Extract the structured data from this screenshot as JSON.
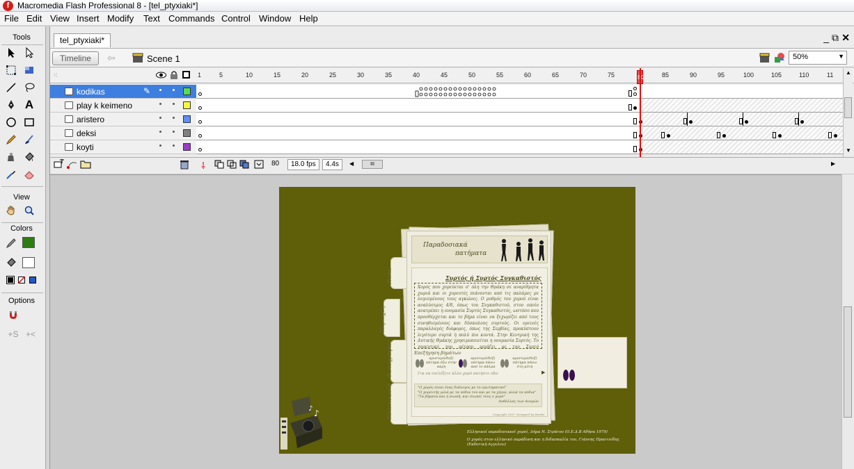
{
  "window": {
    "title": "Macromedia Flash Professional 8 - [tel_ptyxiaki*]",
    "logo_letter": "f"
  },
  "menu": [
    "File",
    "Edit",
    "View",
    "Insert",
    "Modify",
    "Text",
    "Commands",
    "Control",
    "Window",
    "Help"
  ],
  "tools_panel": {
    "header": "Tools",
    "view_header": "View",
    "colors_header": "Colors",
    "options_header": "Options",
    "text_tool_glyph": "A",
    "stroke_color": "#1a1a1a",
    "fill_color": "#2e7d12"
  },
  "document": {
    "tab_label": "tel_ptyxiaki*",
    "timeline_button": "Timeline",
    "scene_label": "Scene 1",
    "zoom": "50%"
  },
  "timeline": {
    "frame_numbers": [
      "1",
      "5",
      "10",
      "15",
      "20",
      "25",
      "30",
      "35",
      "40",
      "45",
      "50",
      "55",
      "60",
      "65",
      "70",
      "75",
      "80",
      "85",
      "90",
      "95",
      "100",
      "105",
      "110",
      "11"
    ],
    "current_frame": "80",
    "fps": "18.0 fps",
    "elapsed": "4.4s",
    "layers": [
      {
        "name": "kodikas",
        "color": "#55dd55",
        "selected": true
      },
      {
        "name": "play k keimeno",
        "color": "#f7f742",
        "selected": false
      },
      {
        "name": "aristero",
        "color": "#5b8ff5",
        "selected": false
      },
      {
        "name": "deksi",
        "color": "#808080",
        "selected": false
      },
      {
        "name": "koyti",
        "color": "#9a3ac8",
        "selected": false
      }
    ]
  },
  "stage": {
    "background_color": "#5f5e09",
    "header_title_line1": "Παραδοσιακά",
    "header_title_line2": "πατήματα",
    "nav_tabs": [
      "Home",
      "Περιοχές",
      "Φωτογραφίες",
      "Επικοινωνία"
    ],
    "article_title": "Συρτός ή Συρτός Συγκαθιστός",
    "article_body": "Χορός που χορεύεται σ' όλη την Θράκη σε αναρίθμητα χωριά και οι χορευτές πιάνονται από τις παλάμες με λυγισμένους τους αγκώνες. Ο ρυθμός του χορού είναι αναλύσιμος 4/8, όπως του Συγκαθιστού, στον οποίο ανατρέπει η ονομασία Συρτός Συγκαθιστός, ωστόσο που προσθέρχεται και το βήμα είναι να ξεχωρίζει από τους συνηθισμένους και δύσκολους συρτούς. Οι ορεινές παραλλαγές διάφορες, όπως της Σερβίας, προκύπτουν λιγότερο συρτά ή πολύ πιο κοντά. Στην Κεντρική της Δυτικής Θράκης χρησιμοποιείται η ονομασία Συρτός. Το χορευτικό του μέτρου μοιάζει με τον Συρτό (Καθιστόγκαλ) χορό. Μελετάτε με τον ίδιο",
    "steps_heading": "Επεξήγηση βημάτων",
    "step_items": [
      "αριστερό/δεξί πάτημα έξω στην ακρη",
      "αριστερό/δεξί πάτημα πάνω από το πάλμα",
      "αριστερό/δεξί πάτημα πάνω στη μύτη"
    ],
    "select_hint": "Για να επιλέξετε άλλο χορό πατήστε εδώ",
    "quote_lines": [
      "\"Ο χορός είναι ένας διάλογος με το ερωτηματικό\"",
      "\"Ο χορευτής μιλά με τα πόδια του και με τα χέρια, αλλά τα πόδια\"",
      "\"Τα βήματα και η σιωπή, και σιωπεί τους ο χορό\""
    ],
    "quote_author": "Ανθέλλας των Ανεμών",
    "copyright": "Copyright 2007, Designed by Hawks",
    "footnote1": "Ελληνικοί παραδοσιακοί χοροί, Δήμα Ν. Στράτου (Ο.Ε.Δ.Β Αθήνα 1979)",
    "footnote2": "Ο χορός στον ελληνικό παράδοση και η διδασκαλία του, Γιάννης Πραντσίδης (Εκδοτική Αγγελου)"
  }
}
